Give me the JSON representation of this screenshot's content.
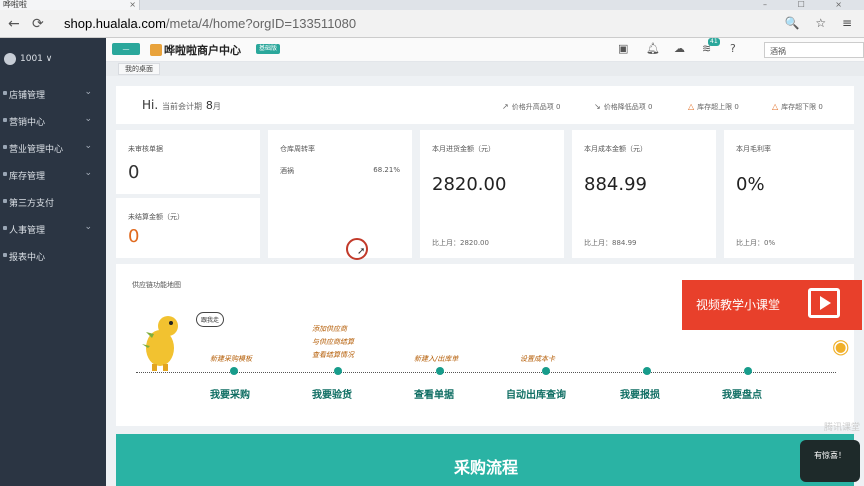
{
  "browser": {
    "tab_title": "哗啦啦",
    "tab_close": "×",
    "url_host": "shop.hualala.com",
    "url_path": "/meta/4/home?orgID=133511080",
    "window_controls": "– ☐ ×",
    "addr_icons": "🔍 ☆ ≡"
  },
  "sidebar": {
    "user_id": "1001 ∨",
    "items": [
      {
        "label": "店铺管理"
      },
      {
        "label": "营销中心"
      },
      {
        "label": "营业管理中心"
      },
      {
        "label": "库存管理"
      },
      {
        "label": "第三方支付"
      },
      {
        "label": "人事管理"
      },
      {
        "label": "报表中心"
      }
    ],
    "chevron": "⌄"
  },
  "header": {
    "green_btn": "—",
    "brand": "哗啦啦商户中心",
    "edition_badge": "基础版",
    "notif_count": "41",
    "search_value": "酒祸"
  },
  "breadcrumb": {
    "tab": "我的桌面"
  },
  "welcome": {
    "hi": "Hi.",
    "period_prefix": "当前会计期",
    "period_value": "8",
    "period_suffix": "月",
    "stats": [
      {
        "label": "价格升高品项",
        "value": "0",
        "icon": "↗"
      },
      {
        "label": "价格降低品项",
        "value": "0",
        "icon": "↘"
      },
      {
        "label": "库存超上限",
        "value": "0",
        "icon": "△"
      },
      {
        "label": "库存超下限",
        "value": "0",
        "icon": "△"
      }
    ]
  },
  "cards": {
    "unreviewed": {
      "label": "未审核单据",
      "value": "0"
    },
    "unsettled": {
      "label": "未结算金额（元）",
      "value": "0"
    },
    "turnover": {
      "label": "仓库周转率",
      "item": "酒祸",
      "rate": "68.21%"
    },
    "purchase": {
      "label": "本月进货金额（元）",
      "value": "2820.00",
      "foot": "比上月：2820.00"
    },
    "cost": {
      "label": "本月成本金额（元）",
      "value": "884.99",
      "foot": "比上月：884.99"
    },
    "margin": {
      "label": "本月毛利率",
      "value": "0%",
      "foot": "比上月：0%"
    }
  },
  "supply_map": {
    "title": "供应链功能地图",
    "bubble": "跟我走",
    "hints": [
      "新建采购模板",
      "添加供应商",
      "与供应商结算",
      "查看结算情况",
      "新建入/出库单",
      "设置成本卡"
    ],
    "steps": [
      "我要采购",
      "我要验货",
      "查看单据",
      "自动出库查询",
      "我要报损",
      "我要盘点"
    ],
    "video_banner": "视频教学小课堂"
  },
  "procure_title": "采购流程",
  "watermark": "腾讯课堂",
  "sticker_text": "有惊喜！"
}
